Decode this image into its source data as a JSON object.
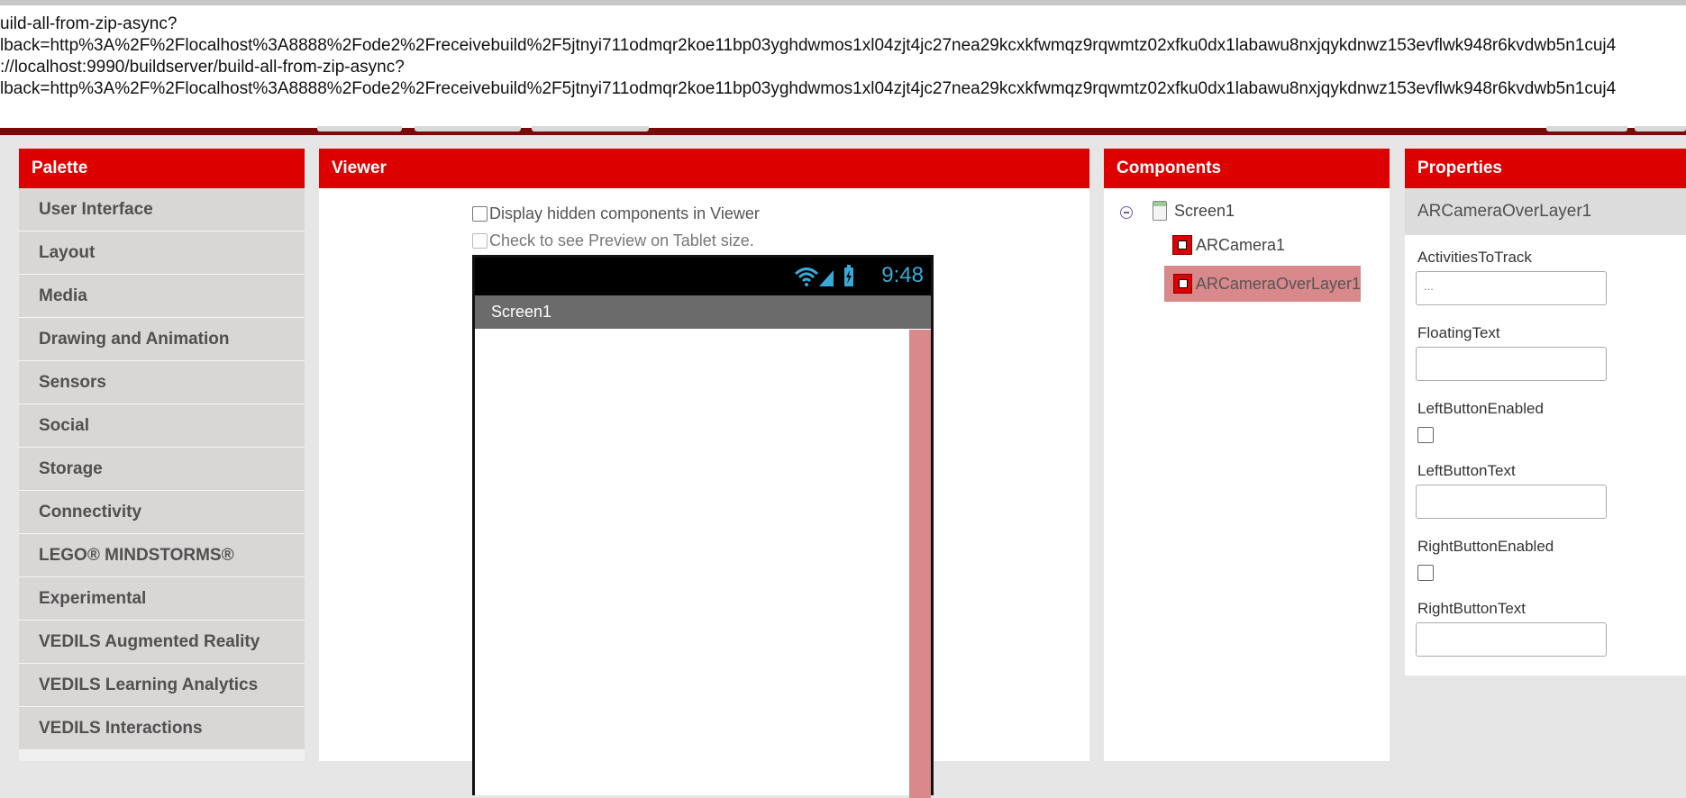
{
  "url_banner": {
    "lines": [
      "uild-all-from-zip-async?",
      "lback=http%3A%2F%2Flocalhost%3A8888%2Fode2%2Freceivebuild%2F5jtnyi711odmqr2koe11bp03yghdwmos1xl04zjt4jc27nea29kcxkfwmqz9rqwmtz02xfku0dx1labawu8nxjqykdnwz153evflwk948r6kvdwb5n1cuj4",
      "://localhost:9990/buildserver/build-all-from-zip-async?",
      "lback=http%3A%2F%2Flocalhost%3A8888%2Fode2%2Freceivebuild%2F5jtnyi711odmqr2koe11bp03yghdwmos1xl04zjt4jc27nea29kcxkfwmqz9rqwmtz02xfku0dx1labawu8nxjqykdnwz153evflwk948r6kvdwb5n1cuj4"
    ]
  },
  "palette": {
    "title": "Palette",
    "items": [
      "User Interface",
      "Layout",
      "Media",
      "Drawing and Animation",
      "Sensors",
      "Social",
      "Storage",
      "Connectivity",
      "LEGO® MINDSTORMS®",
      "Experimental",
      "VEDILS Augmented Reality",
      "VEDILS Learning Analytics",
      "VEDILS Interactions"
    ]
  },
  "viewer": {
    "title": "Viewer",
    "hidden_components_label": "Display hidden components in Viewer",
    "tablet_preview_label": "Check to see Preview on Tablet size.",
    "status_time": "9:48",
    "screen_title": "Screen1"
  },
  "components": {
    "title": "Components",
    "root": "Screen1",
    "children": [
      "ARCamera1",
      "ARCameraOverLayer1"
    ],
    "selected": "ARCameraOverLayer1"
  },
  "properties": {
    "title": "Properties",
    "component_name": "ARCameraOverLayer1",
    "activities_label": "ActivitiesToTrack",
    "activities_value": "...",
    "floating_text_label": "FloatingText",
    "floating_text_value": "",
    "left_button_enabled_label": "LeftButtonEnabled",
    "left_button_text_label": "LeftButtonText",
    "left_button_text_value": "",
    "right_button_enabled_label": "RightButtonEnabled",
    "right_button_text_label": "RightButtonText",
    "right_button_text_value": ""
  },
  "colors": {
    "header_red": "#dd0000",
    "selection": "#d9888b",
    "time_blue": "#39a9d8"
  }
}
